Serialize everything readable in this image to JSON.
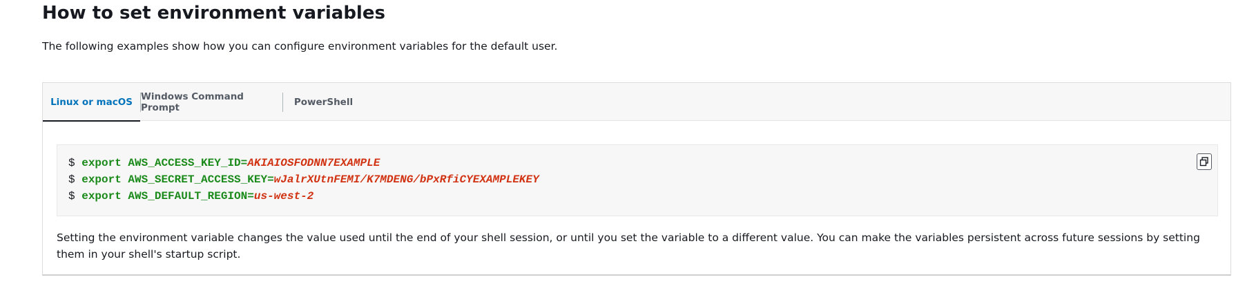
{
  "section": {
    "title": "How to set environment variables",
    "intro": "The following examples show how you can configure environment variables for the default user."
  },
  "tabs": [
    {
      "label": "Linux or macOS",
      "active": true
    },
    {
      "label": "Windows Command Prompt",
      "active": false
    },
    {
      "label": "PowerShell",
      "active": false
    }
  ],
  "code": {
    "lines": [
      {
        "prompt": "$",
        "command": "export AWS_ACCESS_KEY_ID=",
        "value": "AKIAIOSFODNN7EXAMPLE"
      },
      {
        "prompt": "$",
        "command": "export AWS_SECRET_ACCESS_KEY=",
        "value": "wJalrXUtnFEMI/K7MDENG/bPxRfiCYEXAMPLEKEY"
      },
      {
        "prompt": "$",
        "command": "export AWS_DEFAULT_REGION=",
        "value": "us-west-2"
      }
    ],
    "copy_icon": "copy-icon"
  },
  "note": "Setting the environment variable changes the value used until the end of your shell session, or until you set the variable to a different value. You can make the variables persistent across future sessions by setting them in your shell's startup script.",
  "colors": {
    "active_tab": "#0073bb",
    "command": "#1a8a1a",
    "value": "#d13212"
  }
}
